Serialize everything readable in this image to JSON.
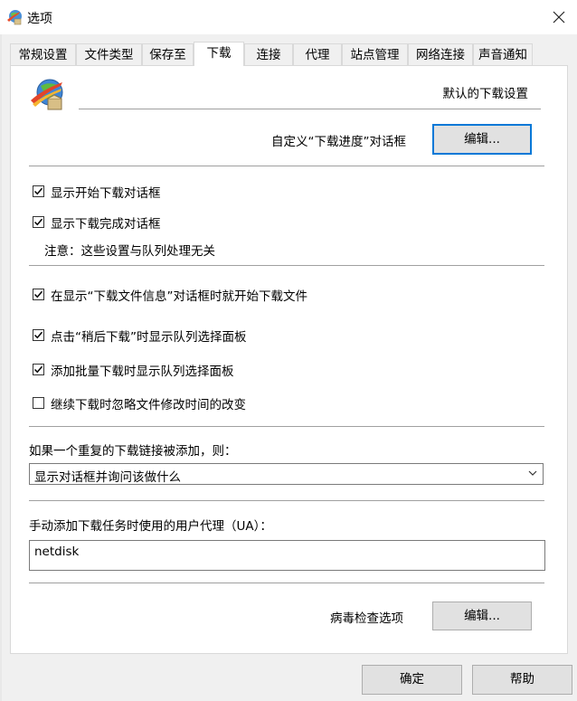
{
  "window": {
    "title": "选项"
  },
  "tabs": [
    {
      "label": "常规设置"
    },
    {
      "label": "文件类型"
    },
    {
      "label": "保存至"
    },
    {
      "label": "下载",
      "active": true
    },
    {
      "label": "连接"
    },
    {
      "label": "代理"
    },
    {
      "label": "站点管理"
    },
    {
      "label": "网络连接"
    },
    {
      "label": "声音通知"
    }
  ],
  "header": {
    "section_title": "默认的下载设置"
  },
  "progress_dialog": {
    "label": "自定义“下载进度”对话框",
    "button": "编辑..."
  },
  "options_group1": [
    {
      "label": "显示开始下载对话框",
      "checked": true
    },
    {
      "label": "显示下载完成对话框",
      "checked": true
    }
  ],
  "note": "注意：这些设置与队列处理无关",
  "options_group2": [
    {
      "label": "在显示“下载文件信息”对话框时就开始下载文件",
      "checked": true
    },
    {
      "label": "点击“稍后下载”时显示队列选择面板",
      "checked": true
    },
    {
      "label": "添加批量下载时显示队列选择面板",
      "checked": true
    },
    {
      "label": "继续下载时忽略文件修改时间的改变",
      "checked": false
    }
  ],
  "duplicate": {
    "label": "如果一个重复的下载链接被添加，则：",
    "selected": "显示对话框并询问该做什么"
  },
  "user_agent": {
    "label": "手动添加下载任务时使用的用户代理（UA）：",
    "value": "netdisk"
  },
  "virus": {
    "label": "病毒检查选项",
    "button": "编辑..."
  },
  "footer": {
    "ok": "确定",
    "help": "帮助"
  }
}
